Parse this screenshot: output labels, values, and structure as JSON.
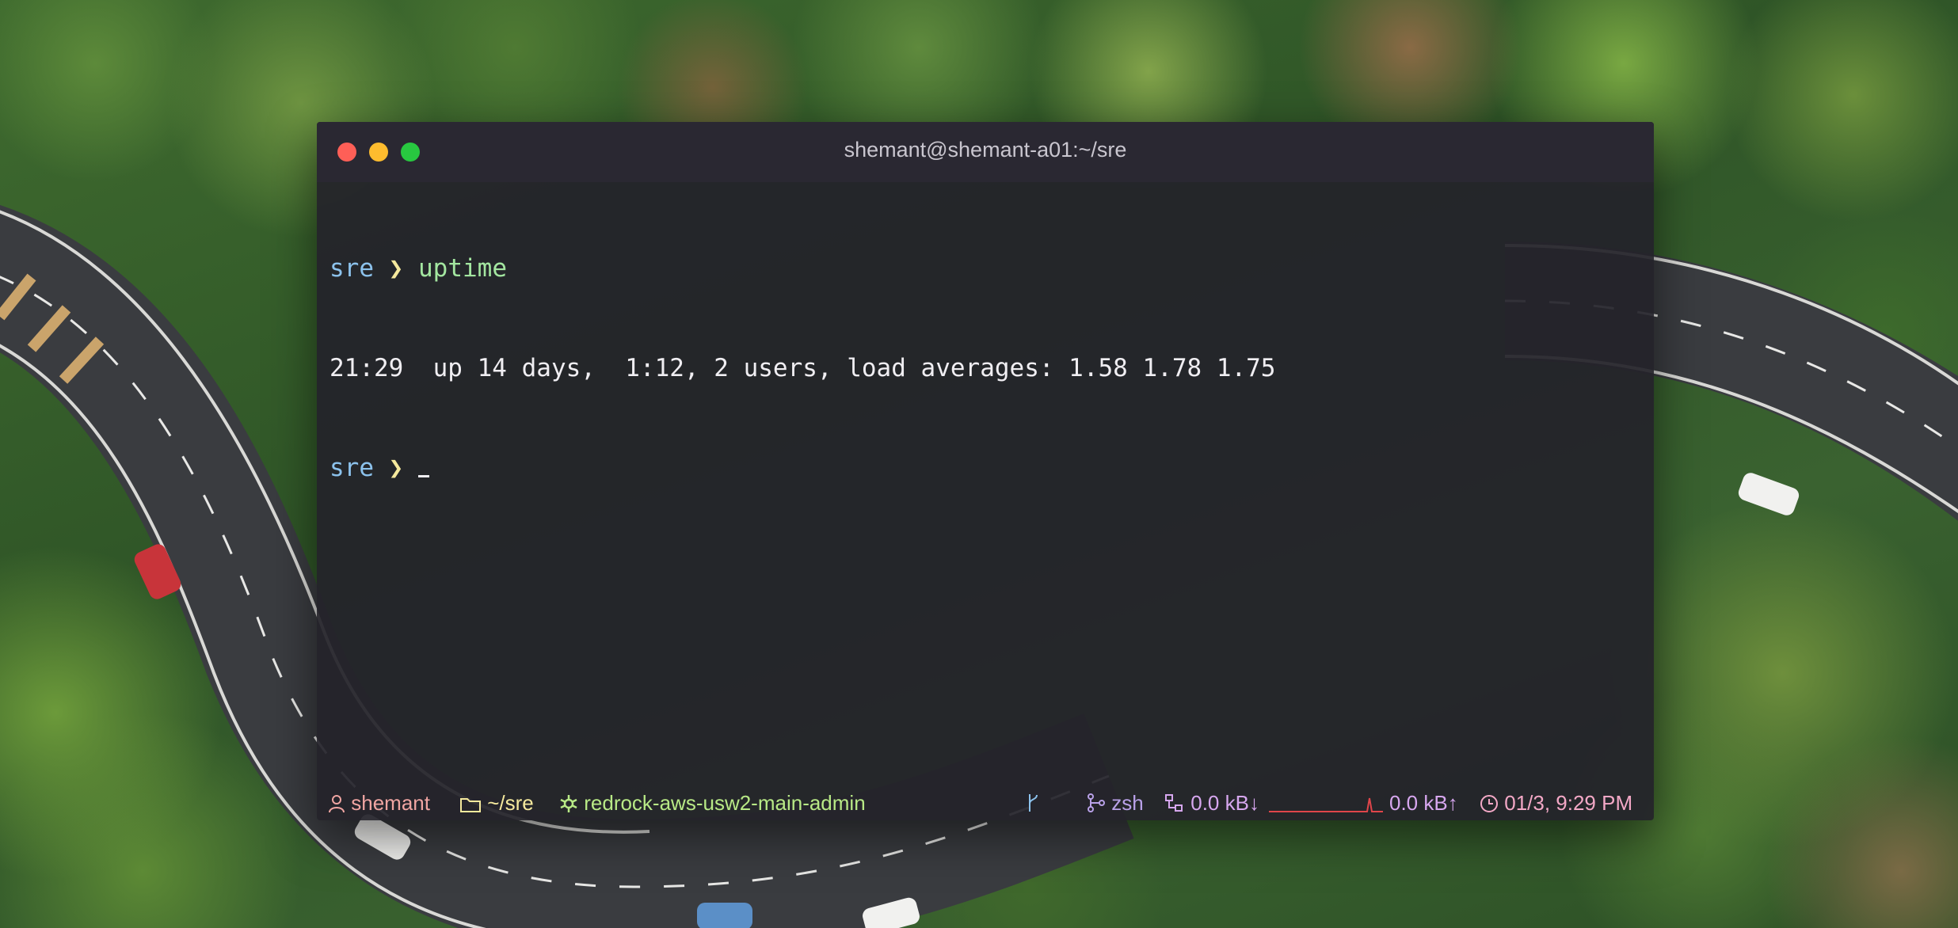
{
  "window": {
    "title": "shemant@shemant-a01:~/sre"
  },
  "terminal": {
    "lines": [
      {
        "dir": "sre",
        "arrow": "❯",
        "command": "uptime"
      },
      {
        "output": "21:29  up 14 days,  1:12, 2 users, load averages: 1.58 1.78 1.75"
      },
      {
        "dir": "sre",
        "arrow": "❯",
        "command": ""
      }
    ]
  },
  "statusbar": {
    "user": "shemant",
    "directory": "~/sre",
    "k8s_context": "redrock-aws-usw2-main-admin",
    "shell": "zsh",
    "net_down": "0.0 kB↓",
    "net_up": "0.0 kB↑",
    "clock": "01/3, 9:29 PM",
    "icons": [
      "user-icon",
      "folder-icon",
      "kubernetes-icon",
      "git-branch-icon",
      "shell-icon",
      "network-icon",
      "clock-icon"
    ]
  },
  "colors": {
    "prompt_dir": "#8cc2ec",
    "prompt_arrow": "#f5e99d",
    "command": "#a3e6a0",
    "sparkline": "#e0454a"
  }
}
